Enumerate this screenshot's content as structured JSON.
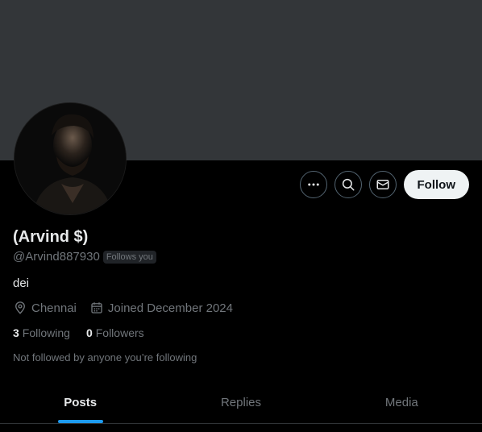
{
  "profile": {
    "display_name": "(Arvind $)",
    "handle": "@Arvind887930",
    "follows_you": "Follows you",
    "bio": "dei",
    "location": "Chennai",
    "joined": "Joined December 2024",
    "following_count": "3",
    "following_label": "Following",
    "followers_count": "0",
    "followers_label": "Followers",
    "mutuals_note": "Not followed by anyone you’re following"
  },
  "actions": {
    "more_icon": "more-horizontal-icon",
    "search_icon": "search-icon",
    "message_icon": "mail-icon",
    "follow_label": "Follow"
  },
  "tabs": [
    {
      "label": "Posts",
      "active": true
    },
    {
      "label": "Replies",
      "active": false
    },
    {
      "label": "Media",
      "active": false
    }
  ],
  "colors": {
    "background": "#000000",
    "banner": "#333639",
    "accent": "#1d9bf0",
    "text_primary": "#e7e9ea",
    "text_secondary": "#71767b",
    "follow_button_bg": "#eff3f4"
  }
}
